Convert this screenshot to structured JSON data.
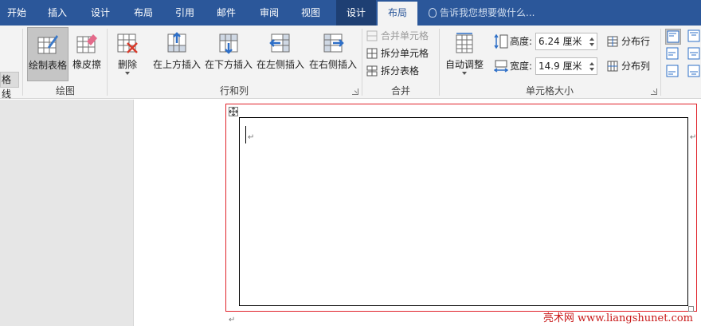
{
  "tabs": {
    "home": "开始",
    "insert": "插入",
    "design": "设计",
    "layout": "布局",
    "references": "引用",
    "mailings": "邮件",
    "review": "审阅",
    "view": "视图",
    "table_design": "设计",
    "table_layout": "布局"
  },
  "tell_me": "告诉我您想要做什么...",
  "ribbon": {
    "left_sliver": "格线",
    "draw": {
      "label": "绘图",
      "draw_table": "绘制表格",
      "eraser": "橡皮擦"
    },
    "rows_cols": {
      "label": "行和列",
      "delete": "删除",
      "insert_above": "在上方插入",
      "insert_below": "在下方插入",
      "insert_left": "在左侧插入",
      "insert_right": "在右侧插入"
    },
    "merge": {
      "label": "合并",
      "merge_cells": "合并单元格",
      "split_cells": "拆分单元格",
      "split_table": "拆分表格"
    },
    "cell_size": {
      "label": "单元格大小",
      "autofit": "自动调整",
      "height_label": "高度:",
      "height_value": "6.24 厘米",
      "width_label": "宽度:",
      "width_value": "14.9 厘米",
      "distribute_rows": "分布行",
      "distribute_cols": "分布列"
    }
  },
  "document": {
    "watermark": "亮术网 www.liangshunet.com"
  },
  "colors": {
    "ribbon_blue": "#2b579a",
    "selection_red": "#e0222a"
  }
}
